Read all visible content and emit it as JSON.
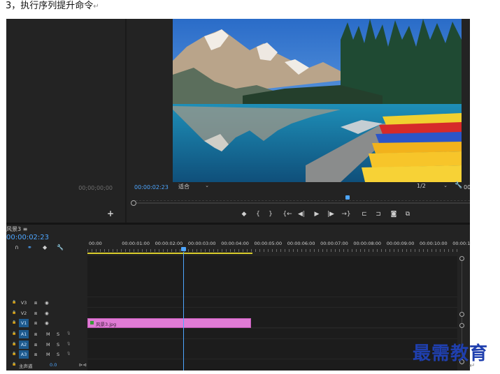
{
  "caption": {
    "text": "3，执行序列提升命令",
    "return_mark": "↵"
  },
  "source_panel": {
    "timecode": "00;00;00;00",
    "add_label": "+"
  },
  "program_monitor": {
    "timecode": "00:00:02:23",
    "fit_value": "适合",
    "resolution_value": "1/2",
    "end_timecode_partial": "00",
    "transport": [
      {
        "name": "add-marker",
        "glyph": "◆"
      },
      {
        "name": "mark-in",
        "glyph": "{"
      },
      {
        "name": "mark-out",
        "glyph": "}"
      },
      {
        "name": "go-to-in",
        "glyph": "{←"
      },
      {
        "name": "step-back",
        "glyph": "◀|"
      },
      {
        "name": "play",
        "glyph": "▶"
      },
      {
        "name": "step-forward",
        "glyph": "|▶"
      },
      {
        "name": "go-to-out",
        "glyph": "→}"
      },
      {
        "name": "lift",
        "glyph": "⊏"
      },
      {
        "name": "extract",
        "glyph": "⊐"
      },
      {
        "name": "export-frame",
        "glyph": "◙"
      },
      {
        "name": "compare",
        "glyph": "⧉"
      }
    ]
  },
  "timeline": {
    "sequence_tab": "风景3 ≡",
    "timecode": "00:00:02:23",
    "ruler_labels": [
      "00:00",
      "00:00:01:00",
      "00:00:02:00",
      "00:00:03:00",
      "00:00:04:00",
      "00:00:05:00",
      "00:00:06:00",
      "00:00:07:00",
      "00:00:08:00",
      "00:00:09:00",
      "00:00:10:00",
      "00:00:1"
    ],
    "tracks": [
      {
        "name": "V3",
        "type": "video",
        "targeted": false
      },
      {
        "name": "V2",
        "type": "video",
        "targeted": false
      },
      {
        "name": "V1",
        "type": "video",
        "targeted": true
      },
      {
        "name": "A1",
        "type": "audio",
        "targeted": true
      },
      {
        "name": "A2",
        "type": "audio",
        "targeted": true
      },
      {
        "name": "A3",
        "type": "audio",
        "targeted": true
      }
    ],
    "master": {
      "label": "主声道",
      "value": "0.0"
    },
    "clip": {
      "label": "风景3.jpg",
      "track": "V1"
    },
    "colors": {
      "playhead": "#4ea6ff",
      "clip": "#e07bd5",
      "work_area": "#d9cc2c",
      "target": "#1d5a8e"
    }
  },
  "watermark": "最需教育",
  "bottom_return_mark": "↵"
}
